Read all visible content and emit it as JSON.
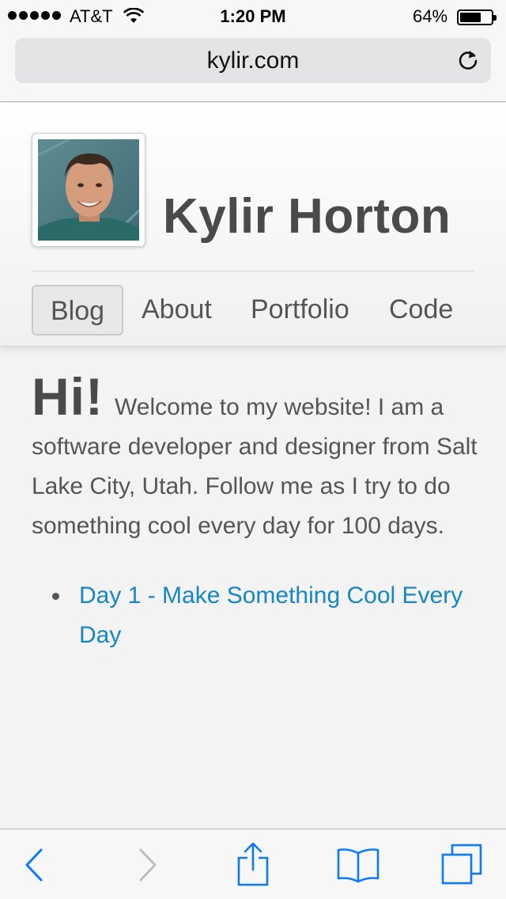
{
  "status_bar": {
    "carrier": "AT&T",
    "time": "1:20 PM",
    "battery_percent": "64%",
    "battery_level": 0.64
  },
  "browser": {
    "url": "kylir.com"
  },
  "site": {
    "name": "Kylir Horton",
    "nav": [
      {
        "label": "Blog",
        "active": true
      },
      {
        "label": "About",
        "active": false
      },
      {
        "label": "Portfolio",
        "active": false
      },
      {
        "label": "Code",
        "active": false
      }
    ]
  },
  "content": {
    "greeting": "Hi!",
    "intro": "Welcome to my website! I am a software developer and designer from Salt Lake City, Utah. Follow me as I try to do something cool every day for 100 days.",
    "posts": [
      {
        "title": "Day 1 - Make Something Cool Every Day"
      }
    ]
  },
  "colors": {
    "link": "#1686c5",
    "ios_blue": "#0a7aff",
    "text": "#555555"
  },
  "toolbar": {
    "icons": [
      "back-icon",
      "forward-icon",
      "share-icon",
      "bookmarks-icon",
      "tabs-icon"
    ]
  }
}
